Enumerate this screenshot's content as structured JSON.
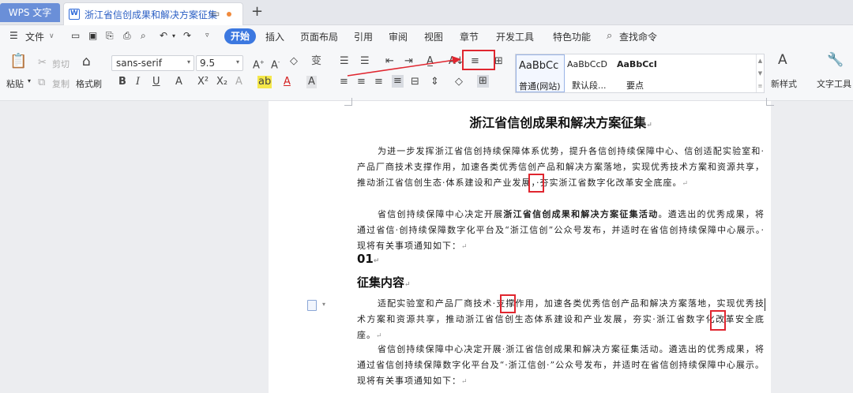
{
  "tabbar": {
    "app_tab": "WPS 文字",
    "doc_tab_title": "浙江省信创成果和解决方案征集",
    "new_tab": "+"
  },
  "menubar": {
    "file_label": "文件",
    "items": [
      "开始",
      "插入",
      "页面布局",
      "引用",
      "审阅",
      "视图",
      "章节",
      "开发工具",
      "特色功能",
      "查找命令"
    ]
  },
  "ribbon": {
    "paste_label": "粘贴",
    "cut_label": "剪切",
    "copy_label": "复制",
    "format_painter_label": "格式刷",
    "font_name": "sans-serif",
    "font_size": "9.5",
    "styles": [
      {
        "preview": "AaBbCc",
        "name": "普通(网站)"
      },
      {
        "preview": "AaBbCcD",
        "name": "默认段..."
      },
      {
        "preview": "AaBbCcI",
        "name": "要点"
      }
    ],
    "new_style_label": "新样式",
    "text_tools_label": "文字工具"
  },
  "document": {
    "title": "浙江省信创成果和解决方案征集",
    "para1": "为进一步发挥浙江省信创持续保障体系优势，提升各信创持续保障中心、信创适配实验室和·产品厂商技术支撑作用，加速各类优秀信创产品和解决方案落地，实现优秀技术方案和资源共享，推动浙江省信创生态·体系建设和产业发展，·夯实浙江省数字化改革安全底座。",
    "para2_prefix": "省信创持续保障中心决定开展",
    "para2_bold": "浙江省信创成果和解决方案征集活动",
    "para2_suffix": "。遴选出的优秀成果，将通过省信·创持续保障数字化平台及“浙江信创”公众号发布，并适时在省信创持续保障中心展示。·现将有关事项通知如下：",
    "section_number": "01",
    "section_heading": "征集内容",
    "para3": "适配实验室和产品厂商技术·支撑作用，加速各类优秀信创产品和解决方案落地，实现优秀技术方案和资源共享，推动浙江省信创生态体系建设和产业发展，夯实·浙江省数字化改革安全底座。",
    "para4": "省信创持续保障中心决定开展·浙江省信创成果和解决方案征集活动。遴选出的优秀成果，将通过省信创持续保障数字化平台及“·浙江信创·”公众号发布，并适时在省信创持续保障中心展示。现将有关事项通知如下："
  },
  "colors": {
    "accent": "#3c78e0",
    "highlight_box": "#e0262f",
    "page": "#ffffff",
    "background": "#ecedf0"
  }
}
